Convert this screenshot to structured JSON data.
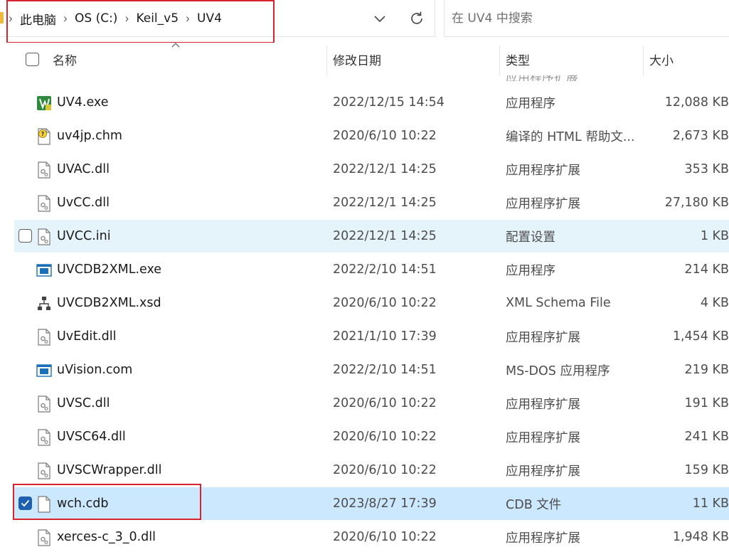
{
  "breadcrumb": [
    "此电脑",
    "OS (C:)",
    "Keil_v5",
    "UV4"
  ],
  "search": {
    "placeholder": "在 UV4 中搜索"
  },
  "columns": {
    "name": "名称",
    "date": "修改日期",
    "type": "类型",
    "size": "大小"
  },
  "partial_row": {
    "type": "应用程序扩展"
  },
  "files": [
    {
      "name": "UV4.exe",
      "date": "2022/12/15 14:54",
      "type": "应用程序",
      "size": "12,088 KB",
      "icon": "uvision-exe-icon"
    },
    {
      "name": "uv4jp.chm",
      "date": "2020/6/10 10:22",
      "type": "编译的 HTML 帮助文...",
      "size": "2,673 KB",
      "icon": "chm-help-icon"
    },
    {
      "name": "UVAC.dll",
      "date": "2022/12/1 14:25",
      "type": "应用程序扩展",
      "size": "353 KB",
      "icon": "dll-file-icon"
    },
    {
      "name": "UvCC.dll",
      "date": "2022/12/1 14:25",
      "type": "应用程序扩展",
      "size": "27,180 KB",
      "icon": "dll-file-icon"
    },
    {
      "name": "UVCC.ini",
      "date": "2022/12/1 14:25",
      "type": "配置设置",
      "size": "1 KB",
      "icon": "ini-file-icon"
    },
    {
      "name": "UVCDB2XML.exe",
      "date": "2022/2/10 14:51",
      "type": "应用程序",
      "size": "214 KB",
      "icon": "exe-window-icon"
    },
    {
      "name": "UVCDB2XML.xsd",
      "date": "2020/6/10 10:22",
      "type": "XML Schema File",
      "size": "4 KB",
      "icon": "xsd-schema-icon"
    },
    {
      "name": "UvEdit.dll",
      "date": "2021/1/10 17:39",
      "type": "应用程序扩展",
      "size": "1,454 KB",
      "icon": "dll-file-icon"
    },
    {
      "name": "uVision.com",
      "date": "2022/2/10 14:51",
      "type": "MS-DOS 应用程序",
      "size": "219 KB",
      "icon": "exe-window-icon"
    },
    {
      "name": "UVSC.dll",
      "date": "2020/6/10 10:22",
      "type": "应用程序扩展",
      "size": "191 KB",
      "icon": "dll-file-icon"
    },
    {
      "name": "UVSC64.dll",
      "date": "2020/6/10 10:22",
      "type": "应用程序扩展",
      "size": "241 KB",
      "icon": "dll-file-icon"
    },
    {
      "name": "UVSCWrapper.dll",
      "date": "2020/6/10 10:22",
      "type": "应用程序扩展",
      "size": "159 KB",
      "icon": "dll-file-icon"
    },
    {
      "name": "wch.cdb",
      "date": "2023/8/27 17:39",
      "type": "CDB 文件",
      "size": "11 KB",
      "icon": "blank-file-icon"
    },
    {
      "name": "xerces-c_3_0.dll",
      "date": "2020/6/10 10:22",
      "type": "应用程序扩展",
      "size": "1,948 KB",
      "icon": "dll-file-icon"
    }
  ],
  "hover_row": "UVCC.ini",
  "selected_row": "wch.cdb",
  "colors": {
    "hover": "#e5f3fb",
    "selected": "#cce8ff",
    "highlight_box": "#d9232e",
    "check": "#1f5fb0"
  }
}
